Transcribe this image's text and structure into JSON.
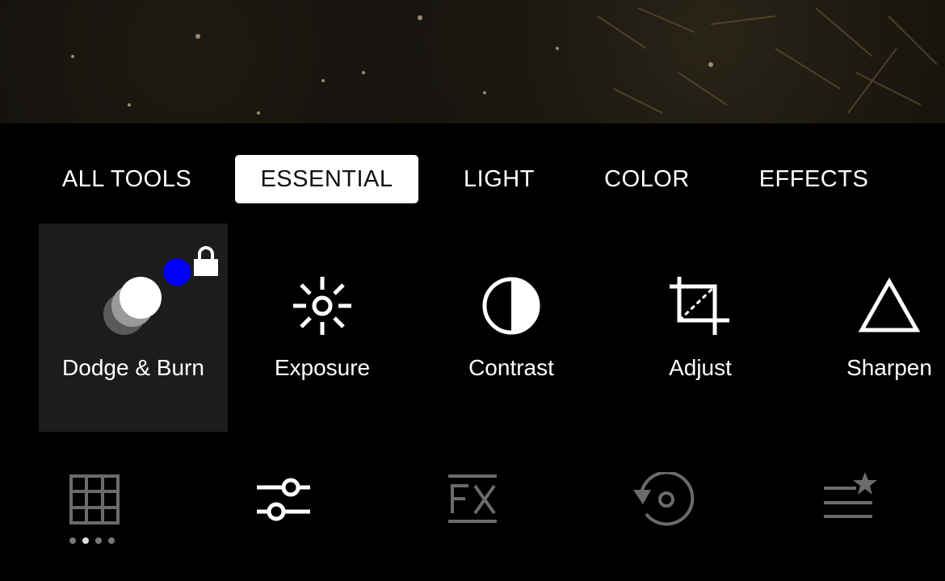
{
  "tabs": [
    {
      "label": "ALL TOOLS",
      "active": false
    },
    {
      "label": "ESSENTIAL",
      "active": true
    },
    {
      "label": "LIGHT",
      "active": false
    },
    {
      "label": "COLOR",
      "active": false
    },
    {
      "label": "EFFECTS",
      "active": false
    }
  ],
  "tools": [
    {
      "label": "Dodge & Burn",
      "icon": "dodge-burn-icon",
      "selected": true,
      "locked": true
    },
    {
      "label": "Exposure",
      "icon": "sun-icon",
      "selected": false
    },
    {
      "label": "Contrast",
      "icon": "contrast-icon",
      "selected": false
    },
    {
      "label": "Adjust",
      "icon": "crop-rotate-icon",
      "selected": false
    },
    {
      "label": "Sharpen",
      "icon": "triangle-icon",
      "selected": false
    }
  ],
  "bottom_nav": [
    {
      "icon": "grid-icon",
      "name": "presets"
    },
    {
      "icon": "sliders-icon",
      "name": "tools",
      "active": true
    },
    {
      "icon": "fx-icon",
      "name": "effects"
    },
    {
      "icon": "history-icon",
      "name": "history"
    },
    {
      "icon": "recipes-star-icon",
      "name": "recipes"
    }
  ],
  "colors": {
    "badge_blue": "#0000ff",
    "selected_bg": "#1c1c1c",
    "inactive_icon": "#6b6b6b"
  }
}
